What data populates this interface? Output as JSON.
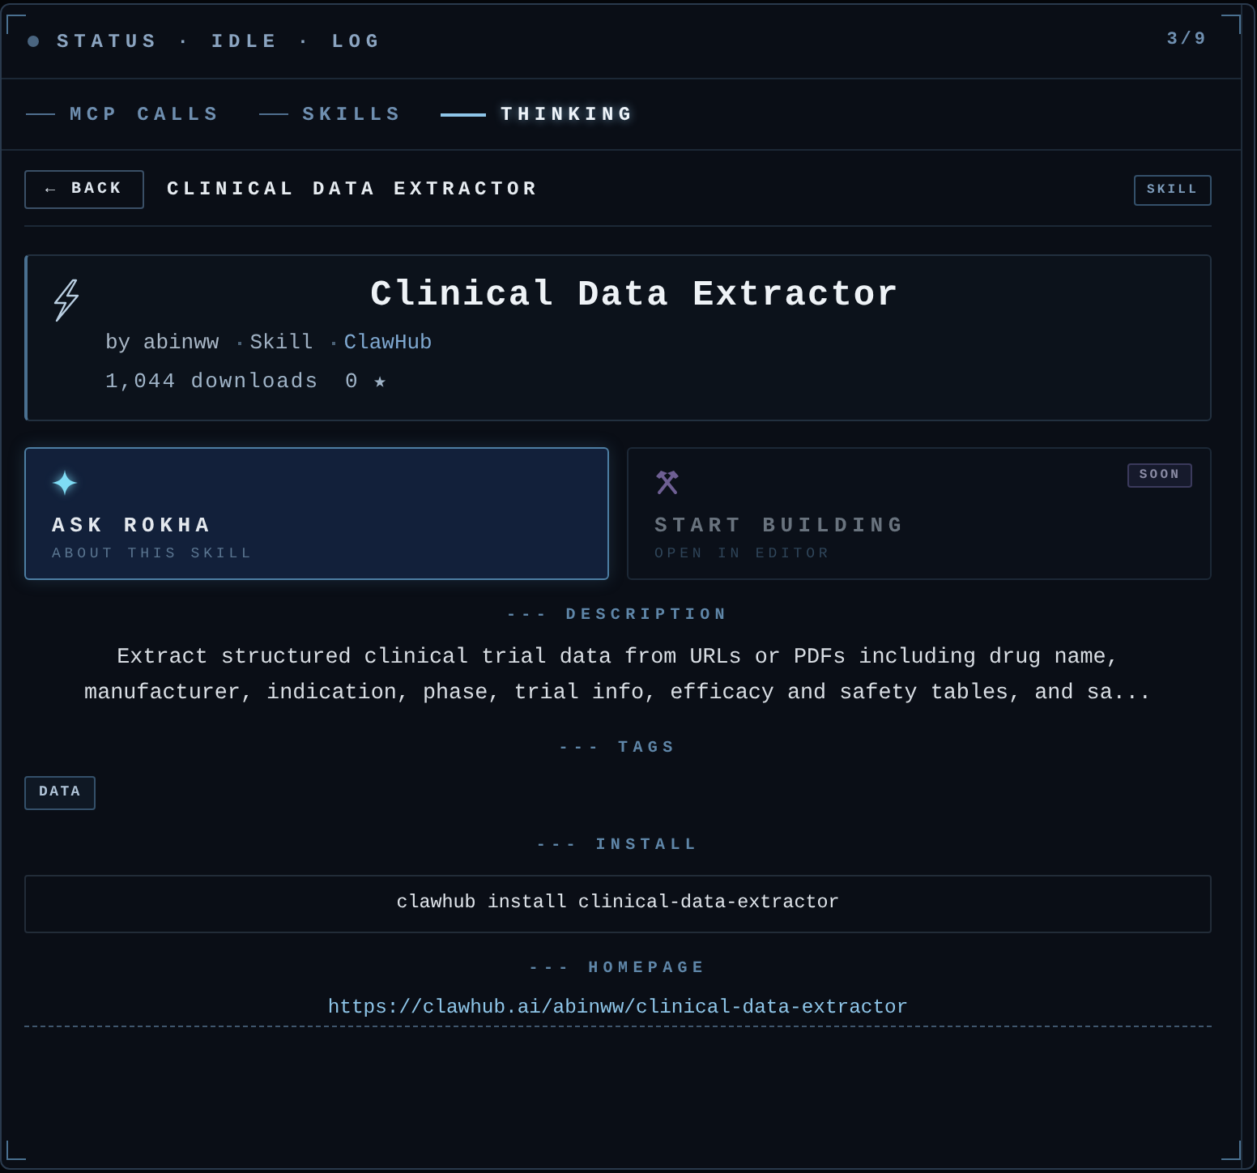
{
  "status_bar": {
    "text": "STATUS · IDLE · LOG",
    "counter": "3/9"
  },
  "tabs": [
    {
      "label": "MCP CALLS",
      "selected": false
    },
    {
      "label": "SKILLS",
      "selected": false
    },
    {
      "label": "THINKING",
      "selected": true
    }
  ],
  "detail_header": {
    "back": "← BACK",
    "title": "CLINICAL DATA EXTRACTOR",
    "badge": "SKILL"
  },
  "skill_card": {
    "title": "Clinical Data Extractor",
    "meta": [
      {
        "kind": "author",
        "text": "by abinww"
      },
      {
        "kind": "type",
        "text": "Skill"
      },
      {
        "kind": "source",
        "text": "ClawHub"
      }
    ],
    "downloads": "1,044 downloads",
    "rating": "0 ★"
  },
  "actions": [
    {
      "kind": "ask",
      "title": "ASK ROKHA",
      "subtitle": "ABOUT THIS SKILL",
      "selected": true,
      "disabled": false
    },
    {
      "kind": "build",
      "title": "START BUILDING",
      "subtitle": "OPEN IN EDITOR",
      "badge": "SOON",
      "selected": false,
      "disabled": true
    }
  ],
  "sections": [
    {
      "kind": "text",
      "heading": "--- DESCRIPTION",
      "text": "Extract structured clinical trial data from URLs or PDFs including drug name, manufacturer, indication, phase, trial info, efficacy and safety tables, and sa..."
    },
    {
      "kind": "tags",
      "heading": "--- TAGS",
      "tags": [
        "DATA"
      ]
    },
    {
      "kind": "code",
      "heading": "--- INSTALL",
      "code": "clawhub install clinical-data-extractor"
    },
    {
      "kind": "link",
      "heading": "--- HOMEPAGE",
      "url": "https://clawhub.ai/abinww/clinical-data-extractor"
    }
  ]
}
